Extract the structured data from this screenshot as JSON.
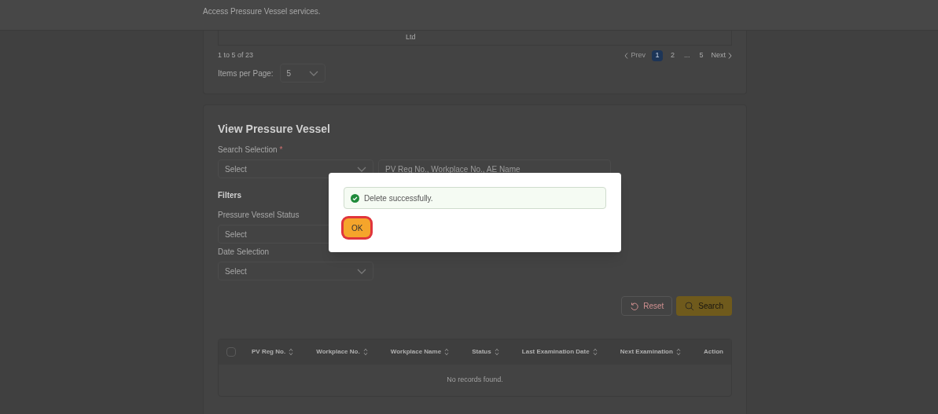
{
  "header": {
    "subtitle": "Access Pressure Vessel services."
  },
  "previous_table": {
    "cut_cell": "Ltd",
    "range": "1 to 5 of 23",
    "pagination": {
      "prev": "Prev",
      "pages": [
        {
          "label": "1",
          "selected": true
        },
        {
          "label": "2",
          "selected": false
        },
        {
          "label": "...",
          "selected": false
        },
        {
          "label": "5",
          "selected": false
        }
      ],
      "next": "Next"
    },
    "items_per_page": {
      "label": "Items per Page:",
      "value": "5"
    }
  },
  "search_card": {
    "title": "View Pressure Vessel",
    "search_selection": {
      "label": "Search Selection",
      "required_mark": "*",
      "value": "Select"
    },
    "search_field": {
      "placeholder": "PV Reg No., Workplace No., AE Name"
    },
    "filters_title": "Filters",
    "filters": [
      {
        "label": "Pressure Vessel Status",
        "value": "Select"
      },
      {
        "label": "Date Selection",
        "value": "Select"
      }
    ],
    "buttons": [
      {
        "kind": "reset",
        "label": "Reset"
      },
      {
        "kind": "search",
        "label": "Search"
      }
    ],
    "table": {
      "select_all_checked": false,
      "columns": [
        {
          "label": "PV Reg No.",
          "sortable": true
        },
        {
          "label": "Workplace No.",
          "sortable": true
        },
        {
          "label": "Workplace Name",
          "sortable": true
        },
        {
          "label": "Status",
          "sortable": true
        },
        {
          "label": "Last Examination Date",
          "sortable": true
        },
        {
          "label": "Next Examination",
          "sortable": true
        },
        {
          "label": "Action",
          "sortable": false
        }
      ],
      "empty": "No records found."
    }
  },
  "dialog": {
    "message": "Delete successfully.",
    "button": "OK"
  }
}
